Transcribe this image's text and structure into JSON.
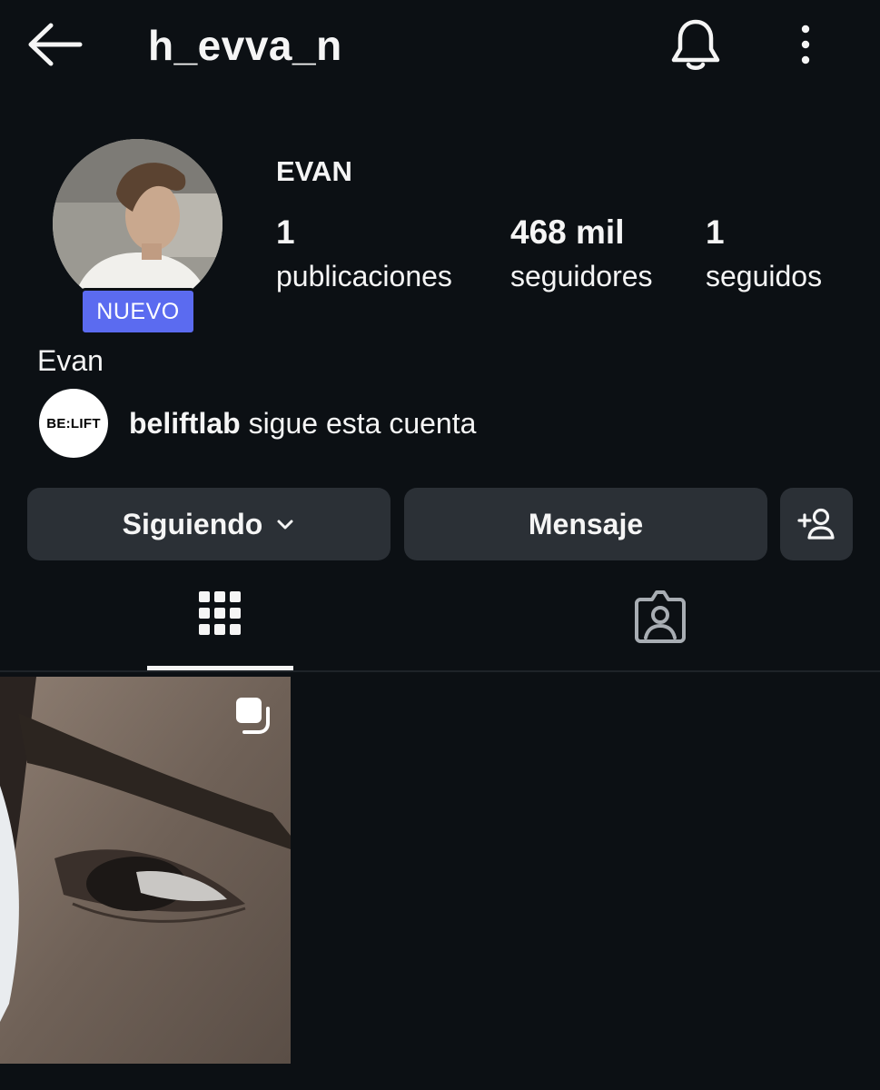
{
  "header": {
    "username": "h_evva_n",
    "back_icon": "arrow-left-icon",
    "notifications_icon": "bell-icon",
    "more_icon": "more-vertical-icon"
  },
  "profile": {
    "badge": "NUEVO",
    "display_name": "EVAN",
    "bio_name": "Evan",
    "stats": [
      {
        "value": "1",
        "label": "publicaciones"
      },
      {
        "value": "468 mil",
        "label": "seguidores"
      },
      {
        "value": "1",
        "label": "seguidos"
      }
    ],
    "followed_by": {
      "logo_text": "BE:LIFT",
      "account": "beliftlab",
      "text": " sigue esta cuenta"
    }
  },
  "actions": {
    "following_label": "Siguiendo",
    "message_label": "Mensaje",
    "add_person_icon": "add-person-icon"
  },
  "tabs": [
    {
      "name": "posts-grid",
      "icon": "grid-icon",
      "active": true
    },
    {
      "name": "tagged",
      "icon": "tagged-person-icon",
      "active": false
    }
  ],
  "colors": {
    "background": "#0c1014",
    "button": "#2b3036",
    "badge": "#5b6bf0",
    "text": "#f5f5f5"
  }
}
